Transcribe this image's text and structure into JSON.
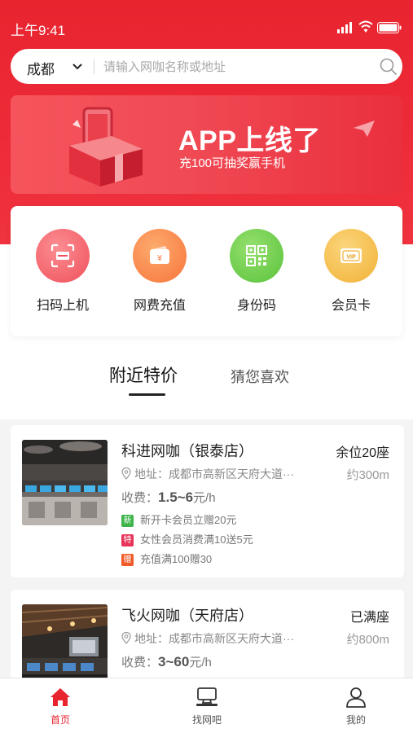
{
  "status": {
    "time": "上午9:41"
  },
  "search": {
    "city": "成都",
    "placeholder": "请输入网咖名称或地址"
  },
  "banner": {
    "title": "APP上线了",
    "subtitle": "充100可抽奖赢手机"
  },
  "quick_actions": [
    {
      "label": "扫码上机",
      "icon": "scan-icon",
      "color": "#f0505a"
    },
    {
      "label": "网费充值",
      "icon": "wallet-icon",
      "color": "#f7743a"
    },
    {
      "label": "身份码",
      "icon": "qrcode-icon",
      "color": "#5bc23b"
    },
    {
      "label": "会员卡",
      "icon": "vip-card-icon",
      "color": "#f1b237"
    }
  ],
  "tabs": [
    {
      "label": "附近特价",
      "active": true
    },
    {
      "label": "猜您喜欢",
      "active": false
    }
  ],
  "cafes": [
    {
      "name": "科进网咖（银泰店）",
      "availability": "余位20座",
      "address": "地址：成都市高新区天府大道···",
      "distance": "约300m",
      "price_label": "收费：",
      "price_value": "1.5~6",
      "price_unit": "元/h",
      "promos": [
        {
          "tag": "新",
          "text": "新开卡会员立赠20元",
          "color": "#3cb44a"
        },
        {
          "tag": "特",
          "text": "女性会员消费满10送5元",
          "color": "#e8345a"
        },
        {
          "tag": "赠",
          "text": "充值满100赠30",
          "color": "#f05a28"
        }
      ]
    },
    {
      "name": "飞火网咖（天府店）",
      "availability": "已满座",
      "address": "地址：成都市高新区天府大道···",
      "distance": "约800m",
      "price_label": "收费：",
      "price_value": "3~60",
      "price_unit": "元/h",
      "promos": []
    }
  ],
  "bottom_nav": [
    {
      "label": "首页",
      "icon": "home-icon",
      "active": true
    },
    {
      "label": "找网吧",
      "icon": "computer-icon",
      "active": false
    },
    {
      "label": "我的",
      "icon": "user-icon",
      "active": false
    }
  ],
  "colors": {
    "brand_red": "#e8242f",
    "active_nav": "#e8242f",
    "inactive_nav": "#555555"
  }
}
